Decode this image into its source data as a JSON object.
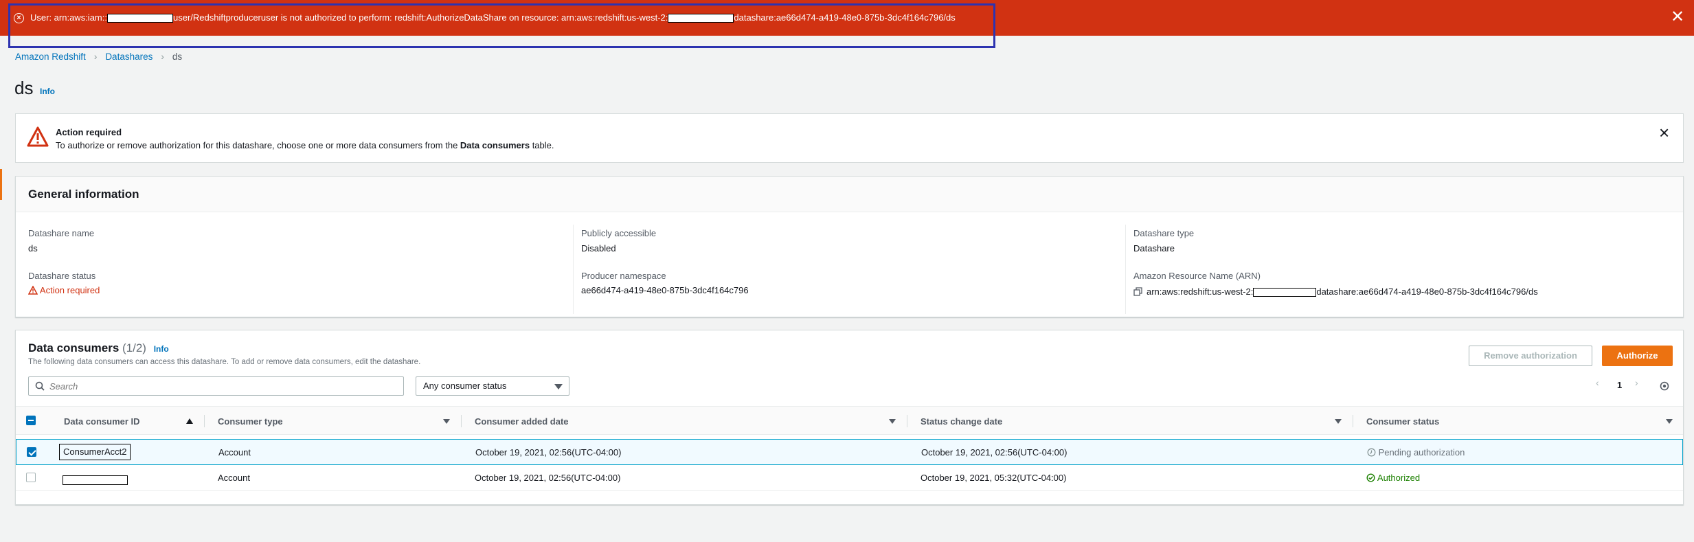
{
  "error_banner": {
    "text_prefix": "User: arn:aws:iam::",
    "text_middle": "user/Redshiftproduceruser is not authorized to perform: redshift:AuthorizeDataShare on resource: arn:aws:redshift:us-west-2:",
    "text_suffix": "datashare:ae66d474-a419-48e0-875b-3dc4f164c796/ds",
    "close_label": "✕",
    "icon": "error-circle-icon",
    "color": "#d13212"
  },
  "breadcrumb": {
    "items": [
      "Amazon Redshift",
      "Datashares"
    ],
    "current": "ds"
  },
  "page": {
    "title": "ds",
    "info_label": "Info"
  },
  "alert": {
    "title": "Action required",
    "body_prefix": "To authorize or remove authorization for this datashare, choose one or more data consumers from the ",
    "body_bold": "Data consumers",
    "body_suffix": " table.",
    "icon": "warning-triangle-icon"
  },
  "general_info": {
    "title": "General information",
    "datashare_name_label": "Datashare name",
    "datashare_name": "ds",
    "datashare_status_label": "Datashare status",
    "datashare_status": "Action required",
    "publicly_accessible_label": "Publicly accessible",
    "publicly_accessible": "Disabled",
    "producer_namespace_label": "Producer namespace",
    "producer_namespace": "ae66d474-a419-48e0-875b-3dc4f164c796",
    "datashare_type_label": "Datashare type",
    "datashare_type": "Datashare",
    "arn_label": "Amazon Resource Name (ARN)",
    "arn_prefix": "arn:aws:redshift:us-west-2:",
    "arn_suffix": "datashare:ae66d474-a419-48e0-875b-3dc4f164c796/ds"
  },
  "data_consumers": {
    "title": "Data consumers",
    "count": "(1/2)",
    "info_label": "Info",
    "description": "The following data consumers can access this datashare. To add or remove data consumers, edit the datashare.",
    "remove_button": "Remove authorization",
    "authorize_button": "Authorize",
    "search_placeholder": "Search",
    "status_filter": "Any consumer status",
    "page": "1",
    "columns": [
      "Data consumer ID",
      "Consumer type",
      "Consumer added date",
      "Status change date",
      "Consumer status"
    ],
    "rows": [
      {
        "id": "ConsumerAcct2",
        "type": "Account",
        "added": "October 19, 2021, 02:56(UTC-04:00)",
        "changed": "October 19, 2021, 02:56(UTC-04:00)",
        "status": "Pending authorization",
        "selected": true
      },
      {
        "id": "",
        "type": "Account",
        "added": "October 19, 2021, 02:56(UTC-04:00)",
        "changed": "October 19, 2021, 05:32(UTC-04:00)",
        "status": "Authorized",
        "selected": false
      }
    ]
  },
  "colors": {
    "accent": "#ec7211",
    "link": "#0073bb",
    "success": "#1d8102",
    "error": "#d13212"
  }
}
